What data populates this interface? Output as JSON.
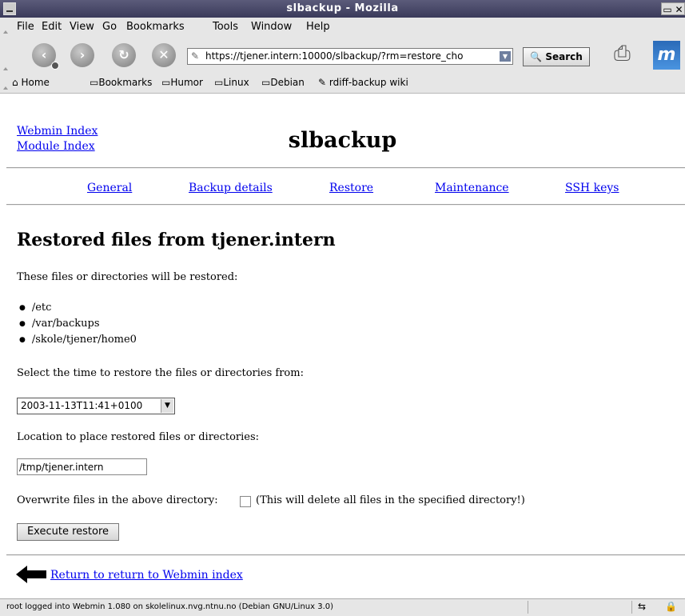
{
  "window": {
    "title": "slbackup - Mozilla"
  },
  "menu": [
    "File",
    "Edit",
    "View",
    "Go",
    "Bookmarks",
    "Tools",
    "Window",
    "Help"
  ],
  "nav": {
    "url": "https://tjener.intern:10000/slbackup/?rm=restore_cho",
    "search_label": "Search"
  },
  "bookmarks": [
    "Home",
    "Bookmarks",
    "Humor",
    "Linux",
    "Debian",
    "rdiff-backup wiki"
  ],
  "page": {
    "webmin_index": "Webmin Index",
    "module_index": "Module Index",
    "module_title": "slbackup",
    "tabs": [
      "General",
      "Backup details",
      "Restore",
      "Maintenance",
      "SSH keys"
    ],
    "heading": "Restored files from tjener.intern",
    "files_intro": "These files or directories will be restored:",
    "files": [
      "/etc",
      "/var/backups",
      "/skole/tjener/home0"
    ],
    "time_label": "Select the time to restore the files or directories from:",
    "time_value": "2003-11-13T11:41+0100",
    "location_label": "Location to place restored files or directories:",
    "location_value": "/tmp/tjener.intern",
    "overwrite_label": "Overwrite files in the above directory:",
    "overwrite_note": "(This will delete all files in the specified directory!)",
    "execute_label": "Execute restore",
    "return_link": "Return to return to Webmin index"
  },
  "status": {
    "text": "root logged into Webmin 1.080 on skolelinux.nvg.ntnu.no (Debian GNU/Linux 3.0)"
  }
}
